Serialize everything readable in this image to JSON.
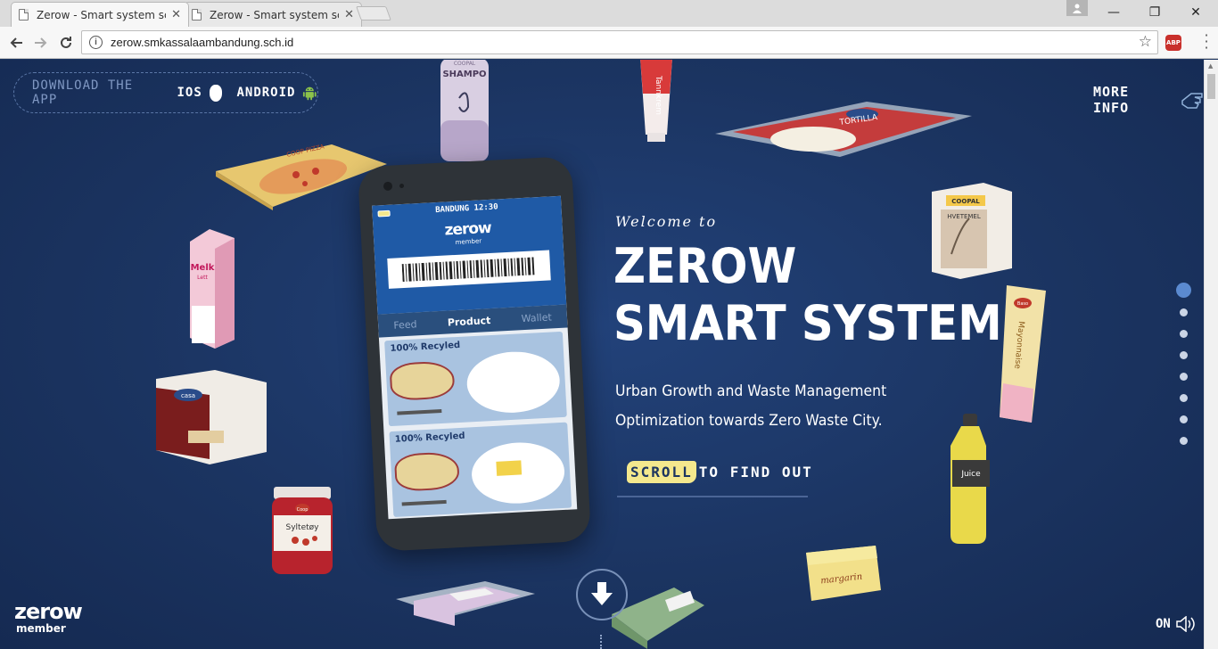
{
  "browser": {
    "tabs": [
      {
        "title": "Zerow - Smart system sc",
        "close": "✕"
      },
      {
        "title": "Zerow - Smart system sc",
        "close": "✕"
      }
    ],
    "url": "zerow.smkassalaambandung.sch.id",
    "window_controls": {
      "minimize": "—",
      "restore": "❐",
      "close": "✕"
    },
    "extension_label": "ABP"
  },
  "header": {
    "download_label": "DOWNLOAD THE APP",
    "ios_label": "IOS",
    "android_label": "ANDROID",
    "more_info_label": "MORE INFO"
  },
  "hero": {
    "welcome": "Welcome to",
    "title_line1": "ZEROW",
    "title_line2": "SMART SYSTEM",
    "subtitle_line1": "Urban Growth and Waste Management",
    "subtitle_line2": "Optimization towards Zero Waste City.",
    "scroll_highlight": "SCROLL",
    "scroll_rest": "TO FIND OUT"
  },
  "phone": {
    "status": "BANDUNG 12:30",
    "app_name": "zerow",
    "app_sub": "member",
    "tabs": [
      "Feed",
      "Product",
      "Wallet"
    ],
    "active_tab": "Product",
    "cards": [
      {
        "label": "100% Recyled"
      },
      {
        "label": "100% Recyled"
      }
    ]
  },
  "products": {
    "shampoo": "SHAMPO",
    "shampoo_brand": "COOPAL",
    "toothpaste": "Tannkrem",
    "tortilla": "TORTILLA",
    "pizza": "COOP PIZZA",
    "milk": "Melk",
    "milk_sub": "Lett",
    "casa": "casa",
    "jam": "Syltetøy",
    "jam_brand": "Coop",
    "flour_brand": "COOPAL",
    "flour": "HVETEMEL",
    "mayo": "Mayonnaise",
    "mayo_brand": "Baso",
    "juice": "Juice",
    "margarine": "margarin"
  },
  "pager": {
    "count": 8,
    "active_index": 0
  },
  "footer": {
    "logo_main": "zerow",
    "logo_sub": "member",
    "sound_label": "ON"
  },
  "colors": {
    "background": "#1c3560",
    "accent_highlight": "#f4e88d",
    "pager_active": "#5b8ad0",
    "phone_header": "#1f5aa6"
  }
}
